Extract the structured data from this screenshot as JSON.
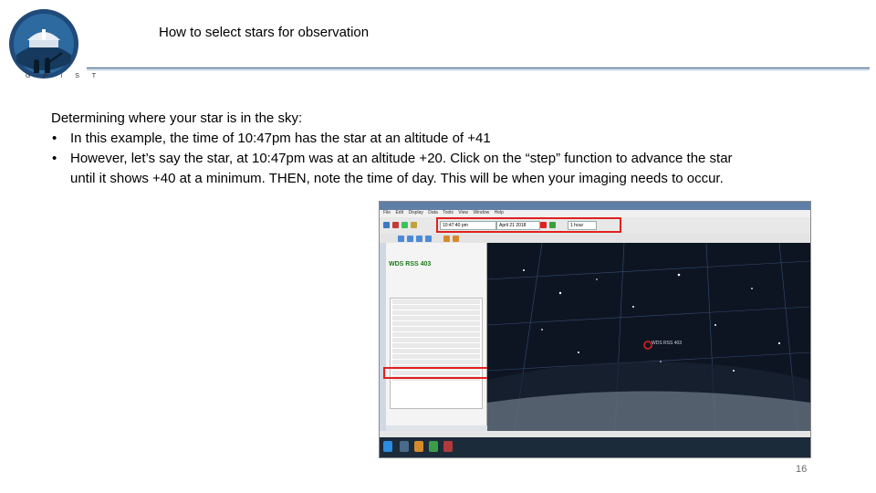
{
  "header": {
    "title": "How to select stars for observation",
    "logo_text": "G R I S T"
  },
  "body": {
    "intro": "Determining where your star is in the sky:",
    "bullets": [
      "In this example, the time of 10:47pm has the star at an altitude of +41",
      "However, let’s say the star, at 10:47pm was at an altitude +20. Click on the “step” function to advance the star until it shows +40 at a minimum. THEN, note the time of day. This will be when your imaging needs to occur."
    ]
  },
  "screenshot": {
    "menu_items": [
      "File",
      "Edit",
      "Display",
      "Data",
      "Tools",
      "View",
      "Window",
      "Help"
    ],
    "time_field": "10:47:40 pm",
    "date_field": "April 21 2018",
    "step_field": "1 hour",
    "object_name": "WDS RSS 403",
    "object_label": "WDS RSS 403",
    "colors": {
      "highlight": "#e0221f",
      "object_name": "#1a7a1a",
      "sky": "#0e1522"
    }
  },
  "footer": {
    "page_number": "16"
  }
}
